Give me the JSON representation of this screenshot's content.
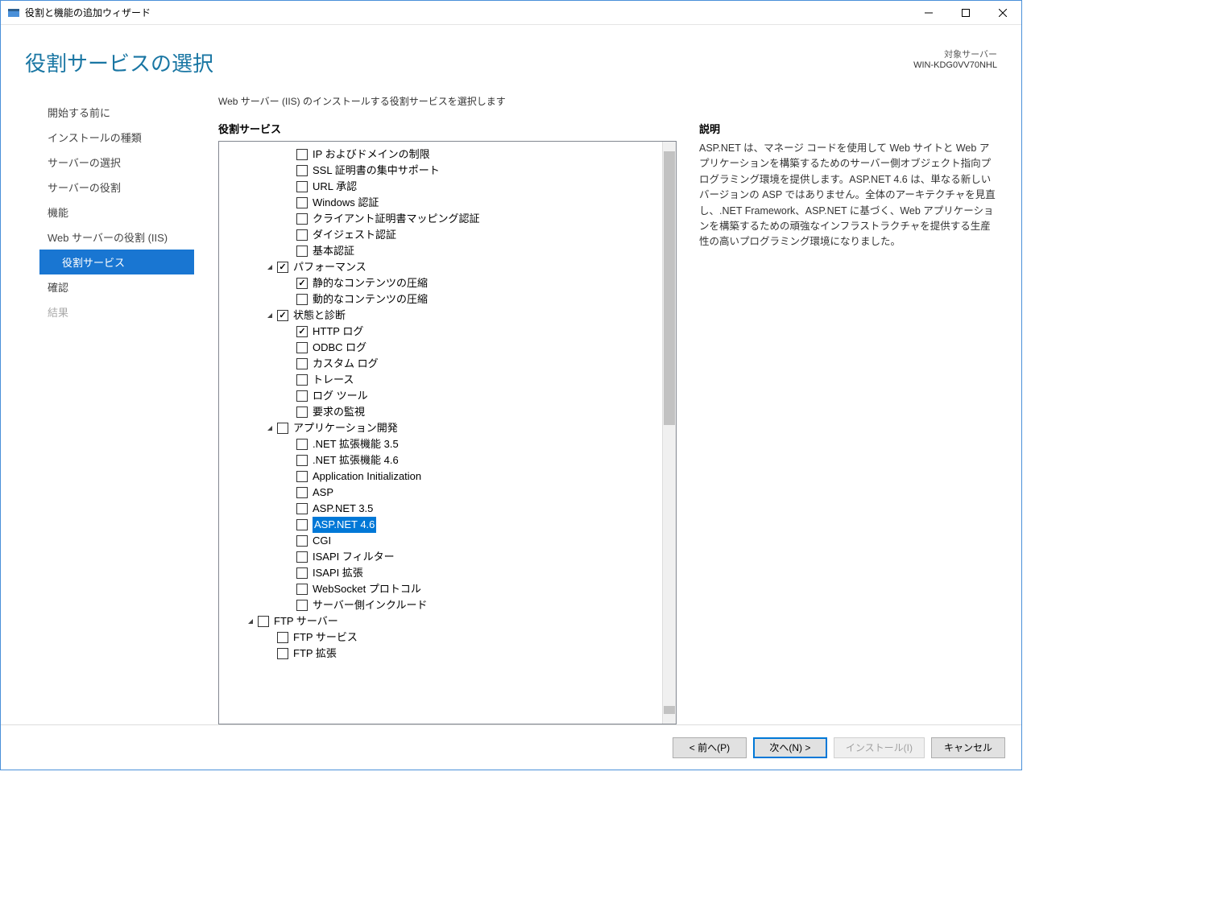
{
  "window": {
    "title": "役割と機能の追加ウィザード"
  },
  "header": {
    "page_title": "役割サービスの選択",
    "target_label": "対象サーバー",
    "target_server": "WIN-KDG0VV70NHL"
  },
  "sidebar": {
    "items": [
      {
        "label": "開始する前に"
      },
      {
        "label": "インストールの種類"
      },
      {
        "label": "サーバーの選択"
      },
      {
        "label": "サーバーの役割"
      },
      {
        "label": "機能"
      },
      {
        "label": "Web サーバーの役割 (IIS)"
      },
      {
        "label": "役割サービス",
        "child": true,
        "selected": true
      },
      {
        "label": "確認"
      },
      {
        "label": "結果",
        "disabled": true
      }
    ]
  },
  "pane": {
    "instruction": "Web サーバー (IIS) のインストールする役割サービスを選択します",
    "roles_label": "役割サービス",
    "desc_label": "説明",
    "description": "ASP.NET は、マネージ コードを使用して Web サイトと Web アプリケーションを構築するためのサーバー側オブジェクト指向プログラミング環境を提供します。ASP.NET 4.6 は、単なる新しいバージョンの ASP ではありません。全体のアーキテクチャを見直し、.NET Framework、ASP.NET に基づく、Web アプリケーションを構築するための頑強なインフラストラクチャを提供する生産性の高いプログラミング環境になりました。"
  },
  "tree": [
    {
      "indent": 3,
      "check": false,
      "label": "IP およびドメインの制限"
    },
    {
      "indent": 3,
      "check": false,
      "label": "SSL 証明書の集中サポート"
    },
    {
      "indent": 3,
      "check": false,
      "label": "URL 承認"
    },
    {
      "indent": 3,
      "check": false,
      "label": "Windows 認証"
    },
    {
      "indent": 3,
      "check": false,
      "label": "クライアント証明書マッピング認証"
    },
    {
      "indent": 3,
      "check": false,
      "label": "ダイジェスト認証"
    },
    {
      "indent": 3,
      "check": false,
      "label": "基本認証"
    },
    {
      "indent": 2,
      "expander": "▲",
      "check": true,
      "label": "パフォーマンス"
    },
    {
      "indent": 3,
      "check": true,
      "label": "静的なコンテンツの圧縮"
    },
    {
      "indent": 3,
      "check": false,
      "label": "動的なコンテンツの圧縮"
    },
    {
      "indent": 2,
      "expander": "▲",
      "check": true,
      "label": "状態と診断"
    },
    {
      "indent": 3,
      "check": true,
      "label": "HTTP ログ"
    },
    {
      "indent": 3,
      "check": false,
      "label": "ODBC ログ"
    },
    {
      "indent": 3,
      "check": false,
      "label": "カスタム ログ"
    },
    {
      "indent": 3,
      "check": false,
      "label": "トレース"
    },
    {
      "indent": 3,
      "check": false,
      "label": "ログ ツール"
    },
    {
      "indent": 3,
      "check": false,
      "label": "要求の監視"
    },
    {
      "indent": 2,
      "expander": "▲",
      "check": false,
      "label": "アプリケーション開発"
    },
    {
      "indent": 3,
      "check": false,
      "label": ".NET 拡張機能 3.5"
    },
    {
      "indent": 3,
      "check": false,
      "label": ".NET 拡張機能 4.6"
    },
    {
      "indent": 3,
      "check": false,
      "label": "Application Initialization"
    },
    {
      "indent": 3,
      "check": false,
      "label": "ASP"
    },
    {
      "indent": 3,
      "check": false,
      "label": "ASP.NET 3.5"
    },
    {
      "indent": 3,
      "check": false,
      "label": "ASP.NET 4.6",
      "selected": true
    },
    {
      "indent": 3,
      "check": false,
      "label": "CGI"
    },
    {
      "indent": 3,
      "check": false,
      "label": "ISAPI フィルター"
    },
    {
      "indent": 3,
      "check": false,
      "label": "ISAPI 拡張"
    },
    {
      "indent": 3,
      "check": false,
      "label": "WebSocket プロトコル"
    },
    {
      "indent": 3,
      "check": false,
      "label": "サーバー側インクルード"
    },
    {
      "indent": 1,
      "expander": "▲",
      "check": false,
      "label": "FTP サーバー"
    },
    {
      "indent": 2,
      "check": false,
      "label": "FTP サービス"
    },
    {
      "indent": 2,
      "check": false,
      "label": "FTP 拡張"
    }
  ],
  "footer": {
    "prev": "< 前へ(P)",
    "next": "次へ(N) >",
    "install": "インストール(I)",
    "cancel": "キャンセル"
  }
}
